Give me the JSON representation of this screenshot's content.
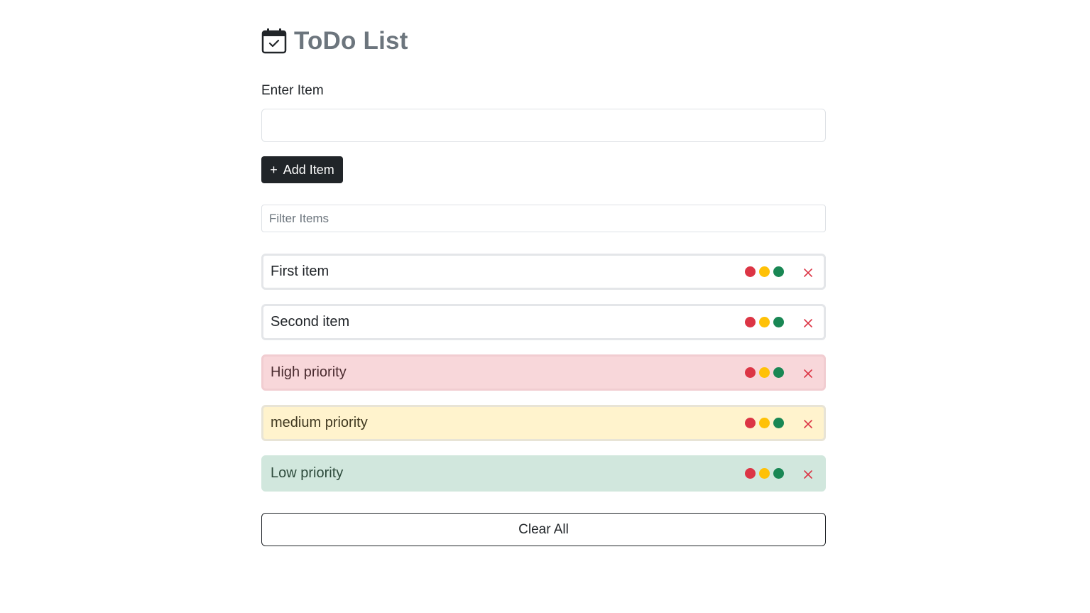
{
  "header": {
    "title": "ToDo List",
    "icon": "calendar-check-icon"
  },
  "form": {
    "label": "Enter Item",
    "item_value": "",
    "item_placeholder": "",
    "add_label": "Add Item",
    "add_icon": "plus-icon"
  },
  "filter": {
    "placeholder": "Filter Items",
    "value": ""
  },
  "items": [
    {
      "text": "First item",
      "priority": "none"
    },
    {
      "text": "Second item",
      "priority": "none"
    },
    {
      "text": "High priority",
      "priority": "high"
    },
    {
      "text": "medium priority",
      "priority": "medium"
    },
    {
      "text": "Low priority",
      "priority": "low"
    }
  ],
  "priority_colors": {
    "high": "#dc3545",
    "medium": "#ffc107",
    "low": "#198754"
  },
  "remove_icon": "close-icon",
  "clear_label": "Clear All"
}
